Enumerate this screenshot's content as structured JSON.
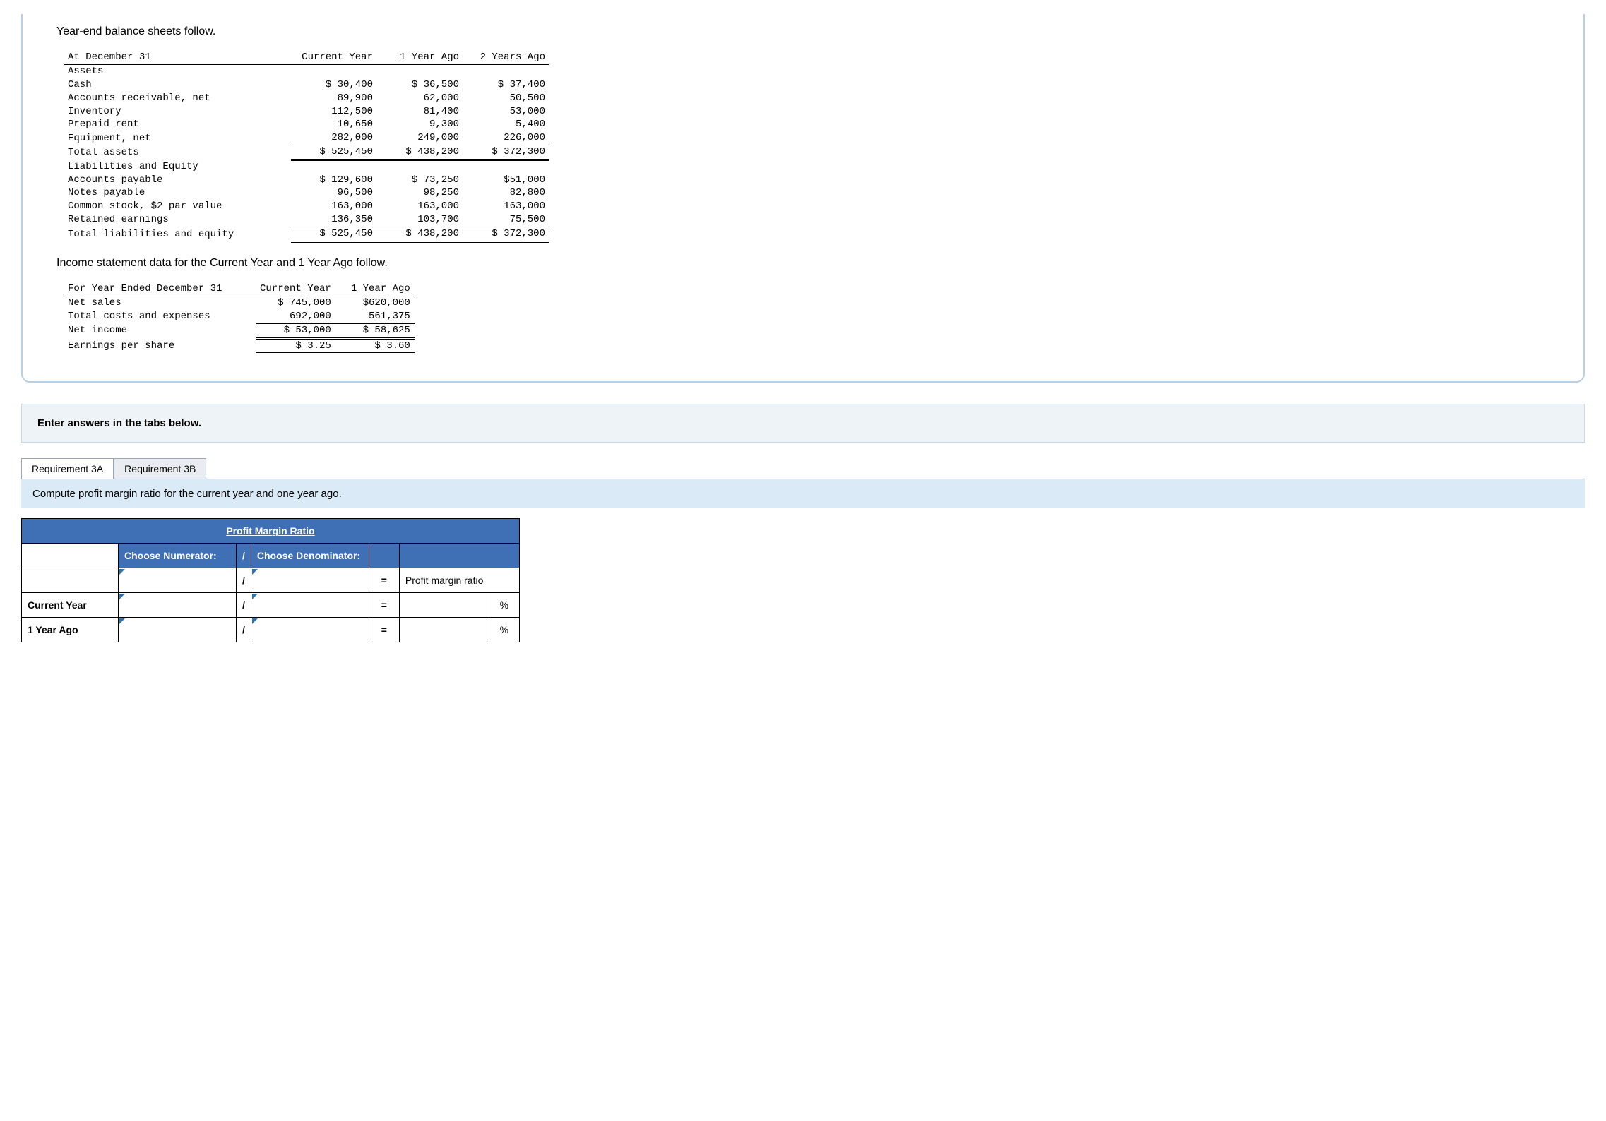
{
  "intro1": "Year-end balance sheets follow.",
  "bs": {
    "header": {
      "c0": "At December 31",
      "c1": "Current Year",
      "c2": "1 Year Ago",
      "c3": "2 Years Ago"
    },
    "assets_hdr": "Assets",
    "rows": {
      "cash": {
        "l": "Cash",
        "c1": "$ 30,400",
        "c2": "$ 36,500",
        "c3": "$ 37,400"
      },
      "ar": {
        "l": "Accounts receivable, net",
        "c1": "89,900",
        "c2": "62,000",
        "c3": "50,500"
      },
      "inv": {
        "l": "Inventory",
        "c1": "112,500",
        "c2": "81,400",
        "c3": "53,000"
      },
      "prepaid": {
        "l": "Prepaid rent",
        "c1": "10,650",
        "c2": "9,300",
        "c3": "5,400"
      },
      "equip": {
        "l": "Equipment, net",
        "c1": "282,000",
        "c2": "249,000",
        "c3": "226,000"
      },
      "ta": {
        "l": "Total assets",
        "c1": "$ 525,450",
        "c2": "$ 438,200",
        "c3": "$ 372,300"
      }
    },
    "le_hdr": "Liabilities and Equity",
    "le": {
      "ap": {
        "l": "Accounts payable",
        "c1": "$ 129,600",
        "c2": "$ 73,250",
        "c3": "$51,000"
      },
      "np": {
        "l": "Notes payable",
        "c1": "96,500",
        "c2": "98,250",
        "c3": "82,800"
      },
      "cs": {
        "l": "Common stock, $2 par value",
        "c1": "163,000",
        "c2": "163,000",
        "c3": "163,000"
      },
      "re": {
        "l": "Retained earnings",
        "c1": "136,350",
        "c2": "103,700",
        "c3": "75,500"
      },
      "tle": {
        "l": "Total liabilities and equity",
        "c1": "$ 525,450",
        "c2": "$ 438,200",
        "c3": "$ 372,300"
      }
    }
  },
  "intro2": "Income statement data for the Current Year and 1 Year Ago follow.",
  "is": {
    "header": {
      "c0": "For Year Ended December 31",
      "c1": "Current Year",
      "c2": "1 Year Ago"
    },
    "rows": {
      "sales": {
        "l": "Net sales",
        "c1": "$ 745,000",
        "c2": "$620,000"
      },
      "costs": {
        "l": "Total costs and expenses",
        "c1": "692,000",
        "c2": "561,375"
      },
      "ni": {
        "l": "Net income",
        "c1": "$ 53,000",
        "c2": "$ 58,625"
      },
      "eps": {
        "l": "Earnings per share",
        "c1": "$ 3.25",
        "c2": "$ 3.60"
      }
    }
  },
  "instr": "Enter answers in the tabs below.",
  "tabs": {
    "a": "Requirement 3A",
    "b": "Requirement 3B"
  },
  "tab_body": "Compute profit margin ratio for the current year and one year ago.",
  "answer": {
    "title": "Profit Margin Ratio",
    "num": "Choose Numerator:",
    "slash": "/",
    "den": "Choose Denominator:",
    "eq": "=",
    "ratio": "Profit margin ratio",
    "cy": "Current Year",
    "y1": "1 Year Ago",
    "pct": "%"
  }
}
